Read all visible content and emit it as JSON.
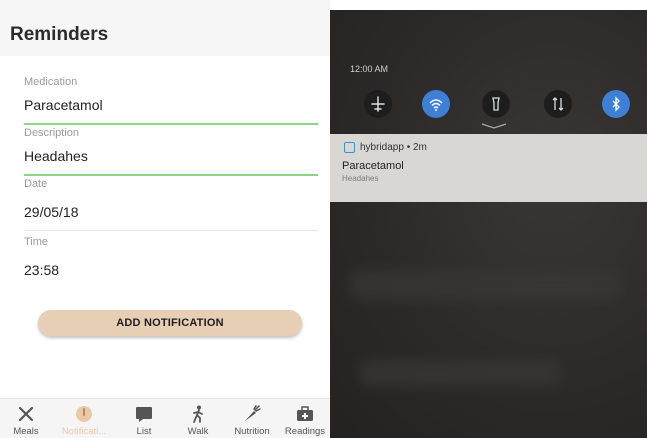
{
  "header": {
    "title": "Reminders"
  },
  "form": {
    "medication": {
      "label": "Medication",
      "value": "Paracetamol"
    },
    "description": {
      "label": "Description",
      "value": "Headahes"
    },
    "date": {
      "label": "Date",
      "value": "29/05/18"
    },
    "time": {
      "label": "Time",
      "value": "23:58"
    },
    "add_button": "ADD NOTIFICATION"
  },
  "tabs": [
    {
      "label": "Meals",
      "icon": "cutlery-icon"
    },
    {
      "label": "Notificati...",
      "icon": "notification-icon",
      "active": true
    },
    {
      "label": "List",
      "icon": "list-icon"
    },
    {
      "label": "Walk",
      "icon": "walk-icon"
    },
    {
      "label": "Nutrition",
      "icon": "carrot-icon"
    },
    {
      "label": "Readings",
      "icon": "medkit-icon"
    }
  ],
  "phone": {
    "clock": "12:00 AM",
    "quick_settings": [
      {
        "icon": "airplane-icon",
        "on": false
      },
      {
        "icon": "wifi-icon",
        "on": true
      },
      {
        "icon": "flashlight-icon",
        "on": false
      },
      {
        "icon": "data-arrows-icon",
        "on": false
      },
      {
        "icon": "bluetooth-icon",
        "on": true
      }
    ],
    "notification": {
      "app": "hybridapp • 2m",
      "title": "Paracetamol",
      "text": "Headahes"
    }
  },
  "colors": {
    "accent": "#8bd686",
    "button": "#e7cfb5",
    "active_tab": "#e9c9a8",
    "qs_on": "#3f7fd6"
  }
}
